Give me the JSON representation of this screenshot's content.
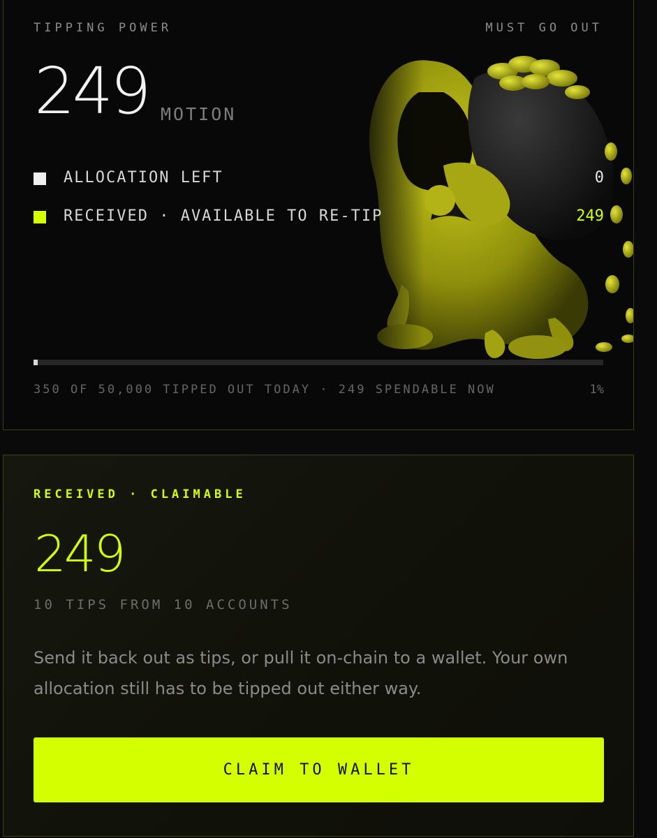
{
  "tipping": {
    "eyebrow": "TIPPING POWER",
    "badge": "MUST GO OUT",
    "amount": "249",
    "unit": "MOTION",
    "legend": [
      {
        "label": "ALLOCATION LEFT",
        "value": "0",
        "color": "#efefef"
      },
      {
        "label": "RECEIVED · AVAILABLE TO RE-TIP",
        "value": "249",
        "color": "#d4ff00"
      }
    ],
    "progress": {
      "fraction": 0.007,
      "summary": "350 OF 50,000 TIPPED OUT TODAY · 249 SPENDABLE NOW",
      "percent": "1%"
    },
    "illustration": "hooded-figure-carrying-coin-sack"
  },
  "claimable": {
    "eyebrow": "RECEIVED · CLAIMABLE",
    "amount": "249",
    "subtitle": "10 TIPS FROM 10 ACCOUNTS",
    "description": "Send it back out as tips, or pull it on-chain to a wallet. Your own allocation still has to be tipped out either way.",
    "button_label": "CLAIM TO WALLET"
  },
  "colors": {
    "accent": "#d4ff00",
    "background": "#0a0a0a",
    "mascot": "#b5b514"
  }
}
